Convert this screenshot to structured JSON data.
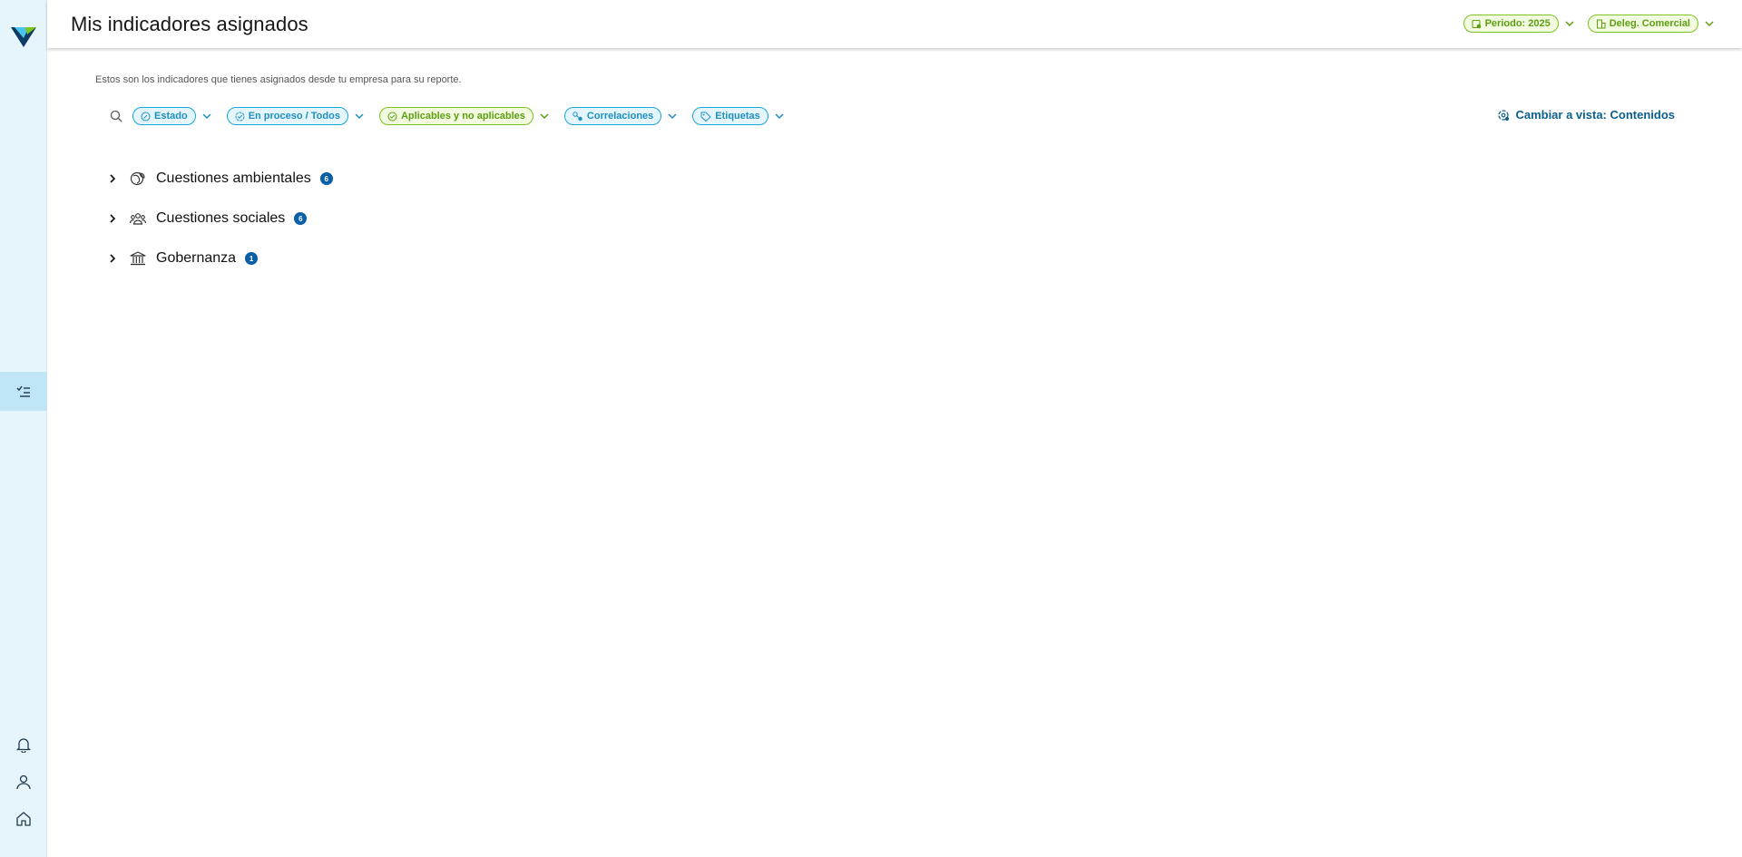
{
  "header": {
    "title": "Mis indicadores asignados",
    "period_label": "Periodo: 2025",
    "delegation_label": "Deleg. Comercial"
  },
  "intro_text": "Estos son los indicadores que tienes asignados desde tu empresa para su reporte.",
  "filters": [
    {
      "label": "Estado",
      "color": "blue",
      "icon": "edit-circle-icon"
    },
    {
      "label": "En proceso / Todos",
      "color": "blue",
      "icon": "check-circle-icon"
    },
    {
      "label": "Aplicables y no aplicables",
      "color": "green",
      "icon": "check-circle-icon"
    },
    {
      "label": "Correlaciones",
      "color": "blue",
      "icon": "link-nodes-icon"
    },
    {
      "label": "Etiquetas",
      "color": "blue",
      "icon": "tag-icon"
    }
  ],
  "view_switch_label": "Cambiar a vista: Contenidos",
  "categories": [
    {
      "label": "Cuestiones ambientales",
      "count": "6",
      "icon": "environment-icon"
    },
    {
      "label": "Cuestiones sociales",
      "count": "6",
      "icon": "people-icon"
    },
    {
      "label": "Gobernanza",
      "count": "1",
      "icon": "institution-icon"
    }
  ],
  "colors": {
    "sidebar_bg": "#e6f4fb",
    "sidebar_active": "#bfe5f7",
    "accent_blue": "#1d8fc2",
    "accent_green": "#5c9e11",
    "badge": "#0a5fa6",
    "link": "#0a5f8e"
  }
}
